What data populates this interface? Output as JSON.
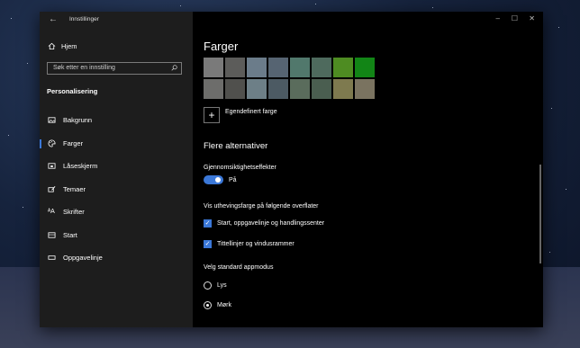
{
  "window": {
    "app_title": "Innstillinger",
    "back_icon": "back-arrow-icon",
    "controls": [
      "–",
      "☐",
      "✕"
    ]
  },
  "sidebar": {
    "home_label": "Hjem",
    "search_placeholder": "Søk etter en innstilling",
    "section_title": "Personalisering",
    "items": [
      {
        "label": "Bakgrunn",
        "icon": "picture-icon",
        "active": false
      },
      {
        "label": "Farger",
        "icon": "palette-icon",
        "active": true
      },
      {
        "label": "Låseskjerm",
        "icon": "lockscreen-icon",
        "active": false
      },
      {
        "label": "Temaer",
        "icon": "brush-icon",
        "active": false
      },
      {
        "label": "Skrifter",
        "icon": "font-icon",
        "active": false
      },
      {
        "label": "Start",
        "icon": "start-icon",
        "active": false
      },
      {
        "label": "Oppgavelinje",
        "icon": "taskbar-icon",
        "active": false
      }
    ]
  },
  "main": {
    "title": "Farger",
    "swatches": [
      "#7a7a7a",
      "#5c5c5a",
      "#6b7c8a",
      "#566472",
      "#51786c",
      "#4e6a5d",
      "#4e8c22",
      "#128516",
      "#6d6d6b",
      "#50504d",
      "#6d7f87",
      "#4c5a63",
      "#5a6c5c",
      "#4a5e50",
      "#7e7a4f",
      "#7a7360"
    ],
    "custom_color_label": "Egendefinert farge",
    "more_options_title": "Flere alternativer",
    "transparency_label": "Gjennomsiktighetseffekter",
    "transparency_state": "På",
    "accent_surfaces_label": "Vis uthevingsfarge på følgende overflater",
    "checkbox_start": "Start, oppgavelinje og handlingssenter",
    "checkbox_titlebars": "Tittellinjer og vindusrammer",
    "app_mode_label": "Velg standard appmodus",
    "radio_light": "Lys",
    "radio_dark": "Mørk",
    "accent_color": "#3b78d8"
  }
}
